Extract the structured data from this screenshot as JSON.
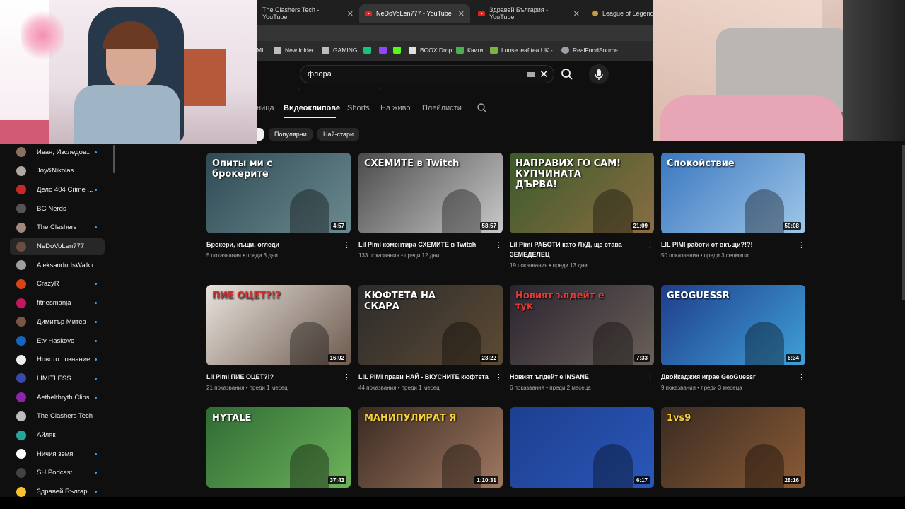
{
  "browser": {
    "tabs": [
      {
        "title": "The Clashers Tech - YouTube",
        "active": false
      },
      {
        "title": "NeDoVoLen777 - YouTube",
        "active": true
      },
      {
        "title": "Здравей България - YouTube",
        "active": false
      },
      {
        "title": "League of Legends Pa",
        "active": false
      }
    ],
    "bookmarks": [
      {
        "label": "MI",
        "color": "#9aa0a6"
      },
      {
        "label": "New folder",
        "color": "#bdbdbd"
      },
      {
        "label": "GAMING",
        "color": "#bdbdbd"
      },
      {
        "label": "",
        "color": "#19c37d"
      },
      {
        "label": "",
        "color": "#9146ff"
      },
      {
        "label": "",
        "color": "#53fc18"
      },
      {
        "label": "BOOX Drop",
        "color": "#e0e0e0"
      },
      {
        "label": "Книги",
        "color": "#4caf50"
      },
      {
        "label": "Loose leaf tea UK -...",
        "color": "#7cb342"
      },
      {
        "label": "RealFoodSource",
        "color": "#9aa0a6"
      }
    ]
  },
  "search": {
    "value": "флора",
    "clear_icon": "close-icon",
    "search_icon": "search-icon",
    "mic_icon": "mic-icon"
  },
  "channel_tabs": [
    "ница",
    "Видеоклипове",
    "Shorts",
    "На живо",
    "Плейлисти"
  ],
  "filter_chips": [
    "Популярни",
    "Най-стари"
  ],
  "sidebar": {
    "items": [
      {
        "label": "Иван, Изследов...",
        "dot": true,
        "active": false,
        "color": "#8d6e63"
      },
      {
        "label": "Joy&Nikolas",
        "dot": false,
        "active": false,
        "color": "#b0a7a2"
      },
      {
        "label": "Дело 404 Crime ...",
        "dot": true,
        "active": false,
        "color": "#c62828"
      },
      {
        "label": "BG Nerds",
        "dot": false,
        "active": false,
        "color": "#555"
      },
      {
        "label": "The Clashers",
        "dot": true,
        "active": false,
        "color": "#a1887f"
      },
      {
        "label": "NeDoVoLen777",
        "dot": false,
        "active": true,
        "color": "#6d4c41"
      },
      {
        "label": "AleksandurIsWalking",
        "dot": false,
        "active": false,
        "color": "#9e9e9e"
      },
      {
        "label": "CrazyR",
        "dot": true,
        "active": false,
        "color": "#d84315"
      },
      {
        "label": "fitnesmanja",
        "dot": true,
        "active": false,
        "color": "#c2185b"
      },
      {
        "label": "Димитър Митев",
        "dot": true,
        "active": false,
        "color": "#795548"
      },
      {
        "label": "Etv Haskovo",
        "dot": true,
        "active": false,
        "color": "#1565c0"
      },
      {
        "label": "Новото познание",
        "dot": true,
        "active": false,
        "color": "#eeeeee"
      },
      {
        "label": "LIMITLESS",
        "dot": true,
        "active": false,
        "color": "#3949ab"
      },
      {
        "label": "Aethelthryth Clips",
        "dot": true,
        "active": false,
        "color": "#8e24aa"
      },
      {
        "label": "The Clashers Tech",
        "dot": false,
        "active": false,
        "color": "#bdbdbd"
      },
      {
        "label": "Айляк",
        "dot": false,
        "active": false,
        "color": "#26a69a"
      },
      {
        "label": "Ничия земя",
        "dot": true,
        "active": false,
        "color": "#ffffff"
      },
      {
        "label": "SH Podcast",
        "dot": true,
        "active": false,
        "color": "#424242"
      },
      {
        "label": "Здравей Българ...",
        "dot": true,
        "active": false,
        "color": "#fbc02d"
      }
    ]
  },
  "videos": [
    {
      "title": "Брокери, къщи, огледи",
      "meta": "5 показвания • преди 3 дни",
      "duration": "4:57",
      "thumb_text": "Опиты ми с брокерите",
      "bg": "#2f4a55",
      "bg2": "#6b8a8f",
      "text_color": "#ffffff"
    },
    {
      "title": "Lil Pimi коментира СХЕМИТЕ в Twitch",
      "meta": "133 показвания • преди 12 дни",
      "duration": "58:57",
      "thumb_text": "СХЕМИТЕ в Twitch",
      "bg": "#4a4a4a",
      "bg2": "#c9c9c9",
      "text_color": "#ffffff"
    },
    {
      "title": "Lil Pimi РАБОТИ като ЛУД, ще става ЗЕМЕДЕЛЕЦ",
      "meta": "19 показвания • преди 13 дни",
      "duration": "21:09",
      "thumb_text": "НАПРАВИХ ГО САМ! КУПЧИНАТА ДЪРВА!",
      "bg": "#3b5a2a",
      "bg2": "#8a6d43",
      "text_color": "#ffffff"
    },
    {
      "title": "LIL PIMI работи от вкъщи?!?!",
      "meta": "50 показвания • преди 3 седмици",
      "duration": "50:08",
      "thumb_text": "Спокойствие",
      "bg": "#3a78c0",
      "bg2": "#9fc6e8",
      "text_color": "#ffffff"
    },
    {
      "title": "Lil Pimi ПИЕ ОЦЕТ?!?",
      "meta": "21 показвания • преди 1 месец",
      "duration": "16:02",
      "thumb_text": "ПИЕ ОЦЕТ?!?",
      "bg": "#e8e2dc",
      "bg2": "#6d5a4e",
      "text_color": "#d32f2f"
    },
    {
      "title": "LIL PIMI прави НАЙ - ВКУСНИТЕ кюфтета",
      "meta": "44 показвания • преди 1 месец",
      "duration": "23:22",
      "thumb_text": "КЮФТЕТА НА СКАРА",
      "bg": "#2c2c2c",
      "bg2": "#5d4a33",
      "text_color": "#ffffff"
    },
    {
      "title": "Новият ъпдейт е INSANE",
      "meta": "6 показвания • преди 2 месеца",
      "duration": "7:33",
      "thumb_text": "Новият ъпдейт е тук",
      "bg": "#2a2430",
      "bg2": "#6a6058",
      "text_color": "#e53935"
    },
    {
      "title": "Двойкаджия играе GeoGuessr",
      "meta": "9 показвания • преди 3 месеца",
      "duration": "6:34",
      "thumb_text": "GEOGUESSR",
      "bg": "#1f3d8a",
      "bg2": "#3fa0d8",
      "text_color": "#ffffff"
    },
    {
      "title": "",
      "meta": "",
      "duration": "37:43",
      "thumb_text": "HYTALE",
      "bg": "#2e6b34",
      "bg2": "#6db35a",
      "text_color": "#ffffff"
    },
    {
      "title": "",
      "meta": "",
      "duration": "1:10:31",
      "thumb_text": "МАНИПУЛИРАТ Я",
      "bg": "#3a2a22",
      "bg2": "#a07860",
      "text_color": "#f7d23a"
    },
    {
      "title": "",
      "meta": "",
      "duration": "6:17",
      "thumb_text": "",
      "bg": "#1d3f8f",
      "bg2": "#2a57b8",
      "text_color": "#ffffff"
    },
    {
      "title": "",
      "meta": "",
      "duration": "28:16",
      "thumb_text": "1vs9",
      "bg": "#3a2c22",
      "bg2": "#8a5a35",
      "text_color": "#f7d23a"
    }
  ]
}
